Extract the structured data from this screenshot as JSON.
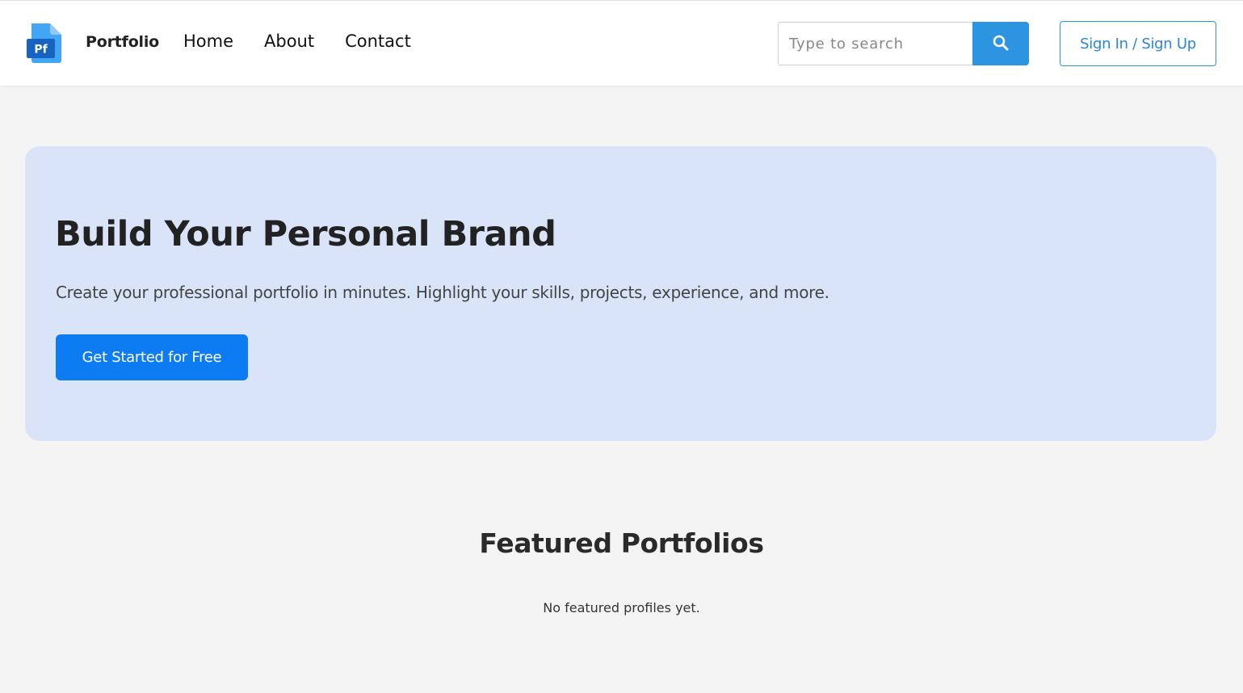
{
  "navbar": {
    "brand_name": "Portfolio",
    "logo_text": "Pf",
    "links": [
      {
        "label": "Home"
      },
      {
        "label": "About"
      },
      {
        "label": "Contact"
      }
    ],
    "search": {
      "placeholder": "Type to search",
      "value": "",
      "button_icon": "search-icon"
    },
    "signin_label": "Sign In / Sign Up"
  },
  "hero": {
    "title": "Build Your Personal Brand",
    "subtitle": "Create your professional portfolio in minutes. Highlight your skills, projects, experience, and more.",
    "cta_label": "Get Started for Free"
  },
  "featured": {
    "title": "Featured Portfolios",
    "empty_message": "No featured profiles yet."
  },
  "colors": {
    "accent": "#2b95e2",
    "cta": "#0d7cf2",
    "hero_bg": "#dae4f8",
    "page_bg": "#f4f4f4"
  }
}
